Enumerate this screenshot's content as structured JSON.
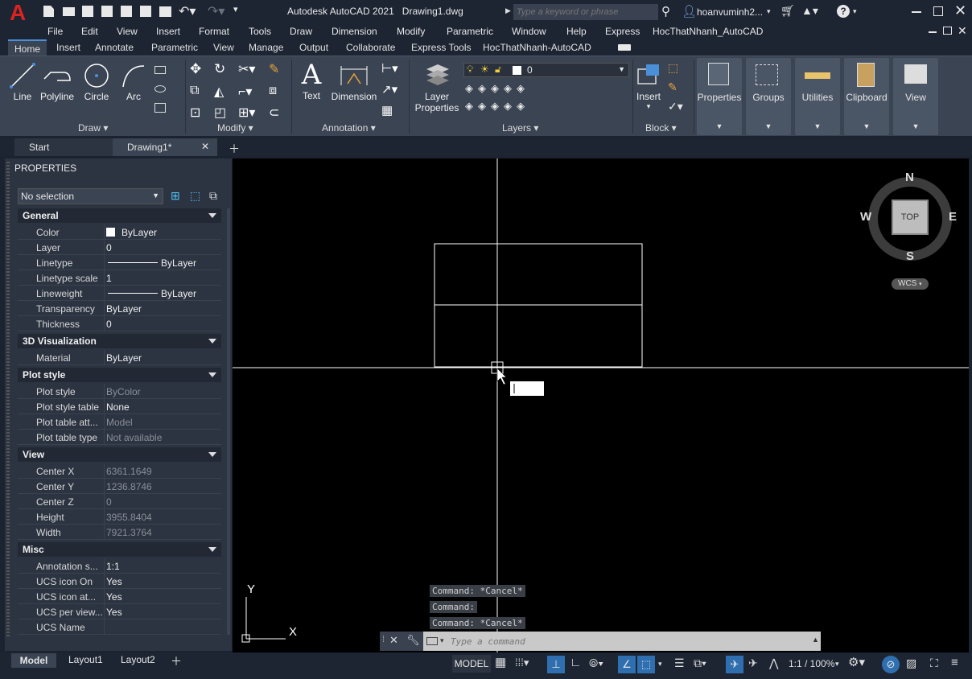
{
  "app": {
    "title": "Autodesk AutoCAD 2021",
    "document": "Drawing1.dwg",
    "search_placeholder": "Type a keyword or phrase",
    "user": "hoanvuminh2...",
    "logo_letter": "A"
  },
  "menu": [
    "File",
    "Edit",
    "View",
    "Insert",
    "Format",
    "Tools",
    "Draw",
    "Dimension",
    "Modify",
    "Parametric",
    "Window",
    "Help",
    "Express",
    "HocThatNhanh_AutoCAD"
  ],
  "ribbon_tabs": [
    "Home",
    "Insert",
    "Annotate",
    "Parametric",
    "View",
    "Manage",
    "Output",
    "Collaborate",
    "Express Tools",
    "HocThatNhanh-AutoCAD"
  ],
  "ribbon": {
    "draw": {
      "line": "Line",
      "polyline": "Polyline",
      "circle": "Circle",
      "arc": "Arc",
      "label": "Draw"
    },
    "modify": {
      "label": "Modify"
    },
    "annotation": {
      "text": "Text",
      "dimension": "Dimension",
      "label": "Annotation"
    },
    "layers": {
      "layer_properties_1": "Layer",
      "layer_properties_2": "Properties",
      "current_layer": "0",
      "label": "Layers"
    },
    "block": {
      "insert": "Insert",
      "label": "Block"
    },
    "properties": "Properties",
    "groups": "Groups",
    "utilities": "Utilities",
    "clipboard": "Clipboard",
    "view": "View"
  },
  "doc_tabs": {
    "start": "Start",
    "drawing": "Drawing1*"
  },
  "properties_panel": {
    "title": "PROPERTIES",
    "selection": "No selection",
    "sections": {
      "general": "General",
      "visualization": "3D Visualization",
      "plot_style": "Plot style",
      "view": "View",
      "misc": "Misc"
    },
    "general": [
      {
        "k": "Color",
        "v": "ByLayer"
      },
      {
        "k": "Layer",
        "v": "0"
      },
      {
        "k": "Linetype",
        "v": "ByLayer"
      },
      {
        "k": "Linetype scale",
        "v": "1"
      },
      {
        "k": "Lineweight",
        "v": "ByLayer"
      },
      {
        "k": "Transparency",
        "v": "ByLayer"
      },
      {
        "k": "Thickness",
        "v": "0"
      }
    ],
    "visualization": [
      {
        "k": "Material",
        "v": "ByLayer"
      }
    ],
    "plot_style": [
      {
        "k": "Plot style",
        "v": "ByColor"
      },
      {
        "k": "Plot style table",
        "v": "None"
      },
      {
        "k": "Plot table att...",
        "v": "Model"
      },
      {
        "k": "Plot table type",
        "v": "Not available"
      }
    ],
    "view": [
      {
        "k": "Center X",
        "v": "6361.1649"
      },
      {
        "k": "Center Y",
        "v": "1236.8746"
      },
      {
        "k": "Center Z",
        "v": "0"
      },
      {
        "k": "Height",
        "v": "3955.8404"
      },
      {
        "k": "Width",
        "v": "7921.3764"
      }
    ],
    "misc": [
      {
        "k": "Annotation s...",
        "v": "1:1"
      },
      {
        "k": "UCS icon On",
        "v": "Yes"
      },
      {
        "k": "UCS icon at...",
        "v": "Yes"
      },
      {
        "k": "UCS per view...",
        "v": "Yes"
      },
      {
        "k": "UCS Name",
        "v": ""
      }
    ]
  },
  "viewcube": {
    "n": "N",
    "s": "S",
    "e": "E",
    "w": "W",
    "top": "TOP",
    "wcs": "WCS"
  },
  "ucs": {
    "x": "X",
    "y": "Y"
  },
  "command_history": [
    "Command: *Cancel*",
    "Command:",
    "Command: *Cancel*"
  ],
  "command_placeholder": "Type a command",
  "layout_tabs": [
    "Model",
    "Layout1",
    "Layout2"
  ],
  "status": {
    "model": "MODEL",
    "scale": "1:1 / 100%"
  }
}
